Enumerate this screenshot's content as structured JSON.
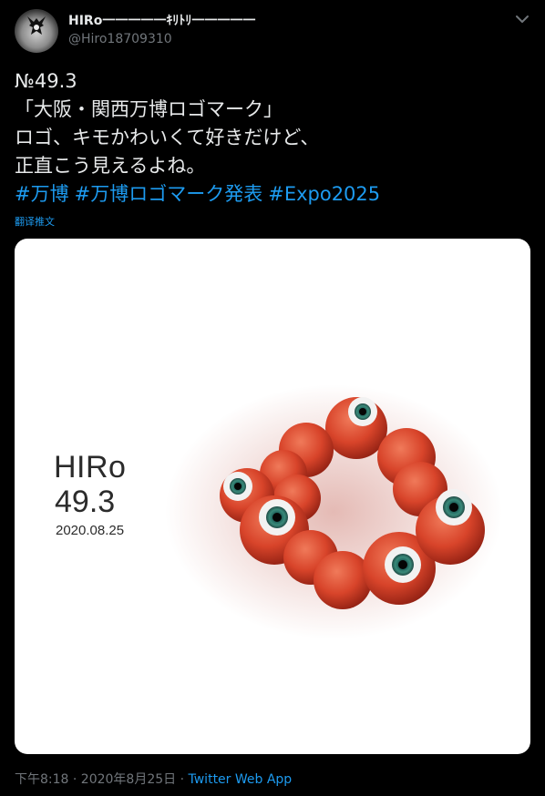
{
  "author": {
    "display_name": "HIRo一一一一一ｷﾘﾄﾘ一一一一一",
    "handle": "@Hiro18709310"
  },
  "tweet": {
    "lines": [
      "№49.3",
      "「大阪・関西万博ロゴマーク」",
      "ロゴ、キモかわいくて好きだけど、",
      "正直こう見えるよね。"
    ],
    "hashtags": [
      "#万博",
      "#万博ロゴマーク発表",
      "#Expo2025"
    ],
    "translate_label": "翻译推文"
  },
  "media": {
    "title": "HIRo",
    "version": "49.3",
    "date": "2020.08.25",
    "icon": "eyeball-ring-artwork"
  },
  "meta": {
    "timestamp": "下午8:18 · 2020年8月25日 · ",
    "source": "Twitter Web App"
  },
  "colors": {
    "background": "#000000",
    "text": "#e7e9ea",
    "secondary": "#71767b",
    "link": "#1d9bf0",
    "ball": "#d8442a"
  }
}
